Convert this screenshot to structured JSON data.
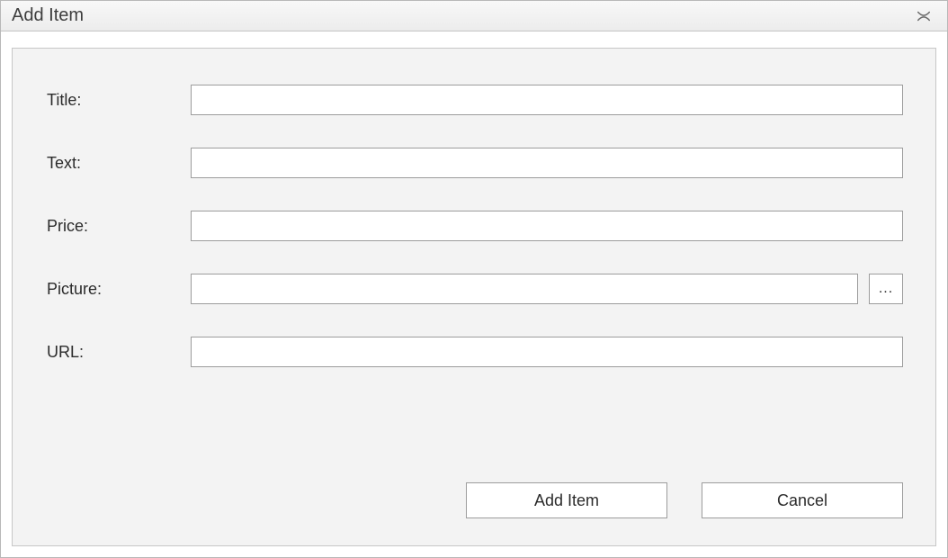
{
  "dialog": {
    "title": "Add Item"
  },
  "form": {
    "title": {
      "label": "Title:",
      "value": ""
    },
    "text": {
      "label": "Text:",
      "value": ""
    },
    "price": {
      "label": "Price:",
      "value": ""
    },
    "picture": {
      "label": "Picture:",
      "value": "",
      "browse": "..."
    },
    "url": {
      "label": "URL:",
      "value": ""
    }
  },
  "buttons": {
    "add": "Add Item",
    "cancel": "Cancel"
  }
}
